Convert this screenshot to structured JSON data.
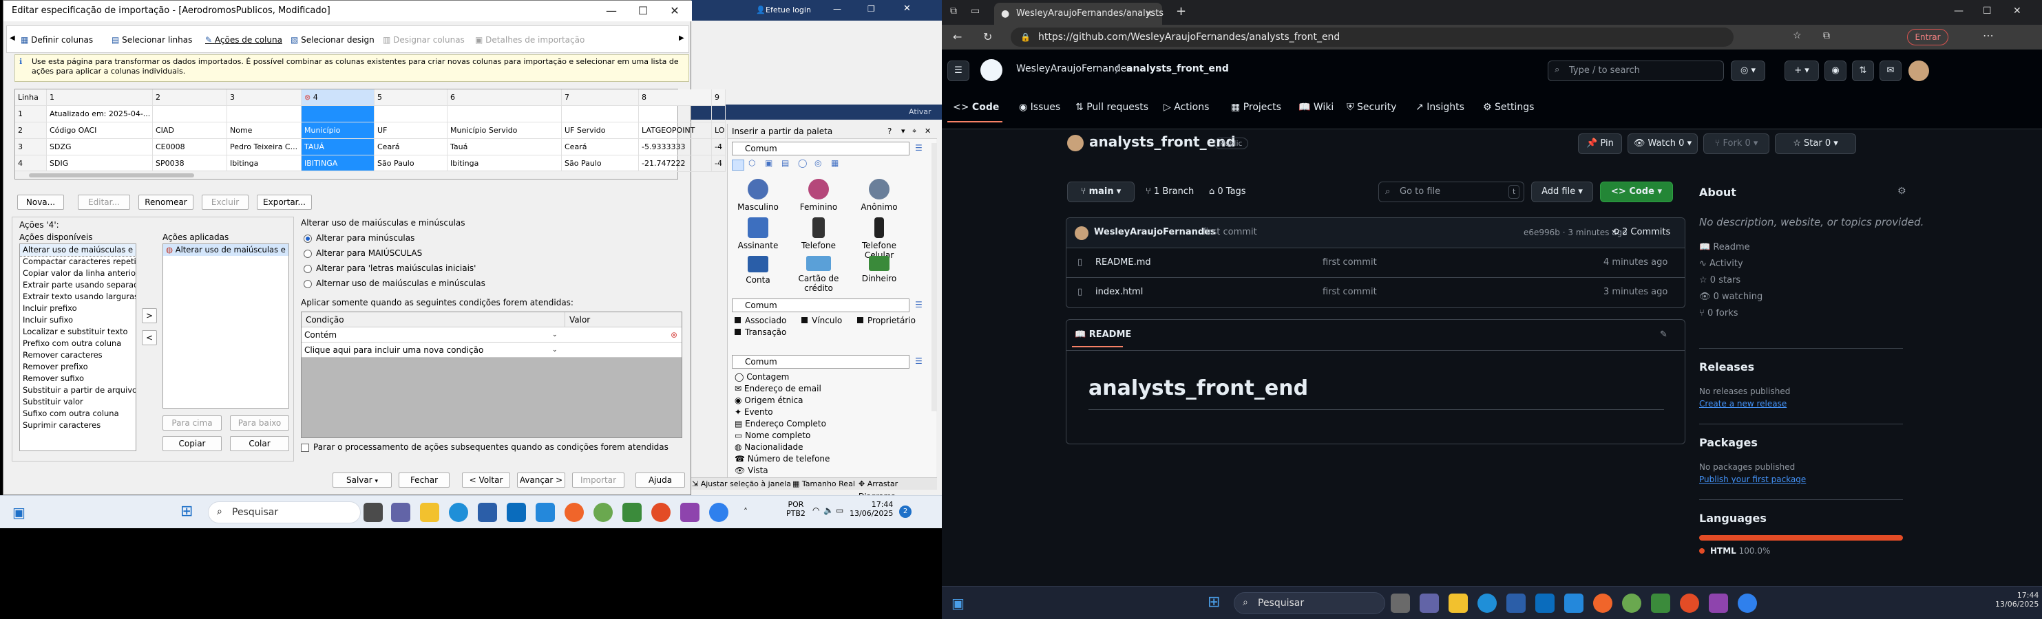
{
  "dialog": {
    "title": "Editar especificação de importação - [AerodromosPublicos, Modificado]",
    "steps": [
      "Definir colunas",
      "Selecionar linhas",
      "Ações de coluna",
      "Selecionar design",
      "Designar colunas",
      "Detalhes de importação"
    ],
    "info": "Use esta página para transformar os dados importados. É possível combinar as colunas existentes para criar novas colunas para importação e selecionar em uma lista de ações para aplicar a colunas individuais.",
    "grid": {
      "headers": [
        "Linha",
        "1",
        "2",
        "3",
        "4",
        "5",
        "6",
        "7",
        "8",
        "9"
      ],
      "rows": [
        [
          "1",
          "Atualizado em: 2025-04-...",
          "",
          "",
          "",
          "",
          "",
          "",
          "",
          ""
        ],
        [
          "2",
          "Código OACI",
          "CIAD",
          "Nome",
          "Município",
          "UF",
          "Município Servido",
          "UF Servido",
          "LATGEOPOINT",
          "LO"
        ],
        [
          "3",
          "SDZG",
          "CE0008",
          "Pedro Teixeira C...",
          "TAUÁ",
          "Ceará",
          "Tauá",
          "Ceará",
          "-5.9333333",
          "-4"
        ],
        [
          "4",
          "SDIG",
          "SP0038",
          "Ibitinga",
          "IBITINGA",
          "São Paulo",
          "Ibitinga",
          "São Paulo",
          "-21.747222",
          "-4"
        ]
      ]
    },
    "row_buttons": [
      "Nova...",
      "Editar...",
      "Renomear",
      "Excluir",
      "Exportar..."
    ],
    "actions_label": "Ações '4':",
    "available_label": "Ações disponíveis",
    "available": [
      "Alterar uso de maiúsculas e mir",
      "Compactar caracteres repetidos",
      "Copiar valor da linha anterior",
      "Extrair parte usando separador",
      "Extrair texto usando larguras fi",
      "Incluir prefixo",
      "Incluir sufixo",
      "Localizar e substituir texto",
      "Prefixo com outra coluna",
      "Remover caracteres",
      "Remover prefixo",
      "Remover sufixo",
      "Substituir a partir de arquivo d",
      "Substituir valor",
      "Sufixo com outra coluna",
      "Suprimir caracteres"
    ],
    "applied_label": "Ações aplicadas",
    "applied": [
      "Alterar uso de maiúsculas e ..."
    ],
    "move_up": "Para cima",
    "move_down": "Para baixo",
    "copy": "Copiar",
    "paste": "Colar",
    "case_group": "Alterar uso de maiúsculas e minúsculas",
    "case_options": [
      "Alterar para minúsculas",
      "Alterar para MAIÚSCULAS",
      "Alterar para 'letras maiúsculas iniciais'",
      "Alternar uso de maiúsculas e minúsculas"
    ],
    "cond_label": "Aplicar somente quando as seguintes condições forem atendidas:",
    "cond_headers": [
      "Condição",
      "Valor"
    ],
    "cond_rows": [
      "Contém",
      "Clique aqui para incluir uma nova condição"
    ],
    "stop_check": "Parar o processamento de ações subsequentes quando as condições forem atendidas",
    "footer": [
      "Salvar",
      "Fechar",
      "< Voltar",
      "Avançar >",
      "Importar",
      "Ajuda"
    ]
  },
  "bgapp": {
    "login": "Efetue login",
    "ativar": "Ativar"
  },
  "palette": {
    "title": "Inserir a partir da paleta",
    "combo": "Comum",
    "items": [
      "Masculino",
      "Feminino",
      "Anônimo",
      "Assinante",
      "Telefone",
      "Telefone Celular",
      "Conta",
      "Cartão de crédito",
      "Dinheiro"
    ],
    "legend": [
      "Associado",
      "Vínculo",
      "Proprietário",
      "Transação"
    ],
    "list": [
      "Contagem",
      "Endereço de email",
      "Origem étnica",
      "Evento",
      "Endereço Completo",
      "Nome completo",
      "Nacionalidade",
      "Número de telefone",
      "Vista"
    ],
    "status": [
      "Ajustar seleção à janela",
      "Tamanho Real",
      "Arrastar Diagrama"
    ]
  },
  "taskbar_left": {
    "search": "Pesquisar",
    "lang": "POR",
    "layout": "PTB2",
    "time": "17:44",
    "date": "13/06/2025",
    "badge": "2"
  },
  "browser": {
    "tab_title": "WesleyAraujoFernandes/analysts",
    "url": "https://github.com/WesleyAraujoFernandes/analysts_front_end",
    "signin": "Entrar"
  },
  "github": {
    "owner": "WesleyAraujoFernandes",
    "repo": "analysts_front_end",
    "search": "Type / to search",
    "nav": [
      "Code",
      "Issues",
      "Pull requests",
      "Actions",
      "Projects",
      "Wiki",
      "Security",
      "Insights",
      "Settings"
    ],
    "visibility": "Public",
    "pin": "Pin",
    "watch": "Watch",
    "watch_count": "0",
    "fork": "Fork",
    "fork_count": "0",
    "star": "Star",
    "star_count": "0",
    "branch": "main",
    "branches": "1 Branch",
    "tags": "0 Tags",
    "goto": "Go to file",
    "goto_key": "t",
    "addfile": "Add file",
    "code_btn": "Code",
    "commit_author": "WesleyAraujoFernandes",
    "commit_msg": "first commit",
    "commit_meta": "e6e996b · 3 minutes ago",
    "commits": "2 Commits",
    "files": [
      {
        "name": "README.md",
        "msg": "first commit",
        "time": "4 minutes ago"
      },
      {
        "name": "index.html",
        "msg": "first commit",
        "time": "3 minutes ago"
      }
    ],
    "readme_tab": "README",
    "readme_h1": "analysts_front_end",
    "about_title": "About",
    "about_desc": "No description, website, or topics provided.",
    "about_items": [
      "Readme",
      "Activity",
      "0 stars",
      "0 watching",
      "0 forks"
    ],
    "releases_title": "Releases",
    "releases_none": "No releases published",
    "releases_link": "Create a new release",
    "packages_title": "Packages",
    "packages_none": "No packages published",
    "packages_link": "Publish your first package",
    "languages_title": "Languages",
    "lang_name": "HTML",
    "lang_pct": "100.0%"
  },
  "taskbar_right": {
    "search": "Pesquisar",
    "time": "17:44",
    "date": "13/06/2025"
  },
  "colors": {
    "gh_bg": "#0d1117",
    "gh_green": "#238636",
    "html_lang": "#e34c26",
    "selection": "#1e90ff"
  }
}
